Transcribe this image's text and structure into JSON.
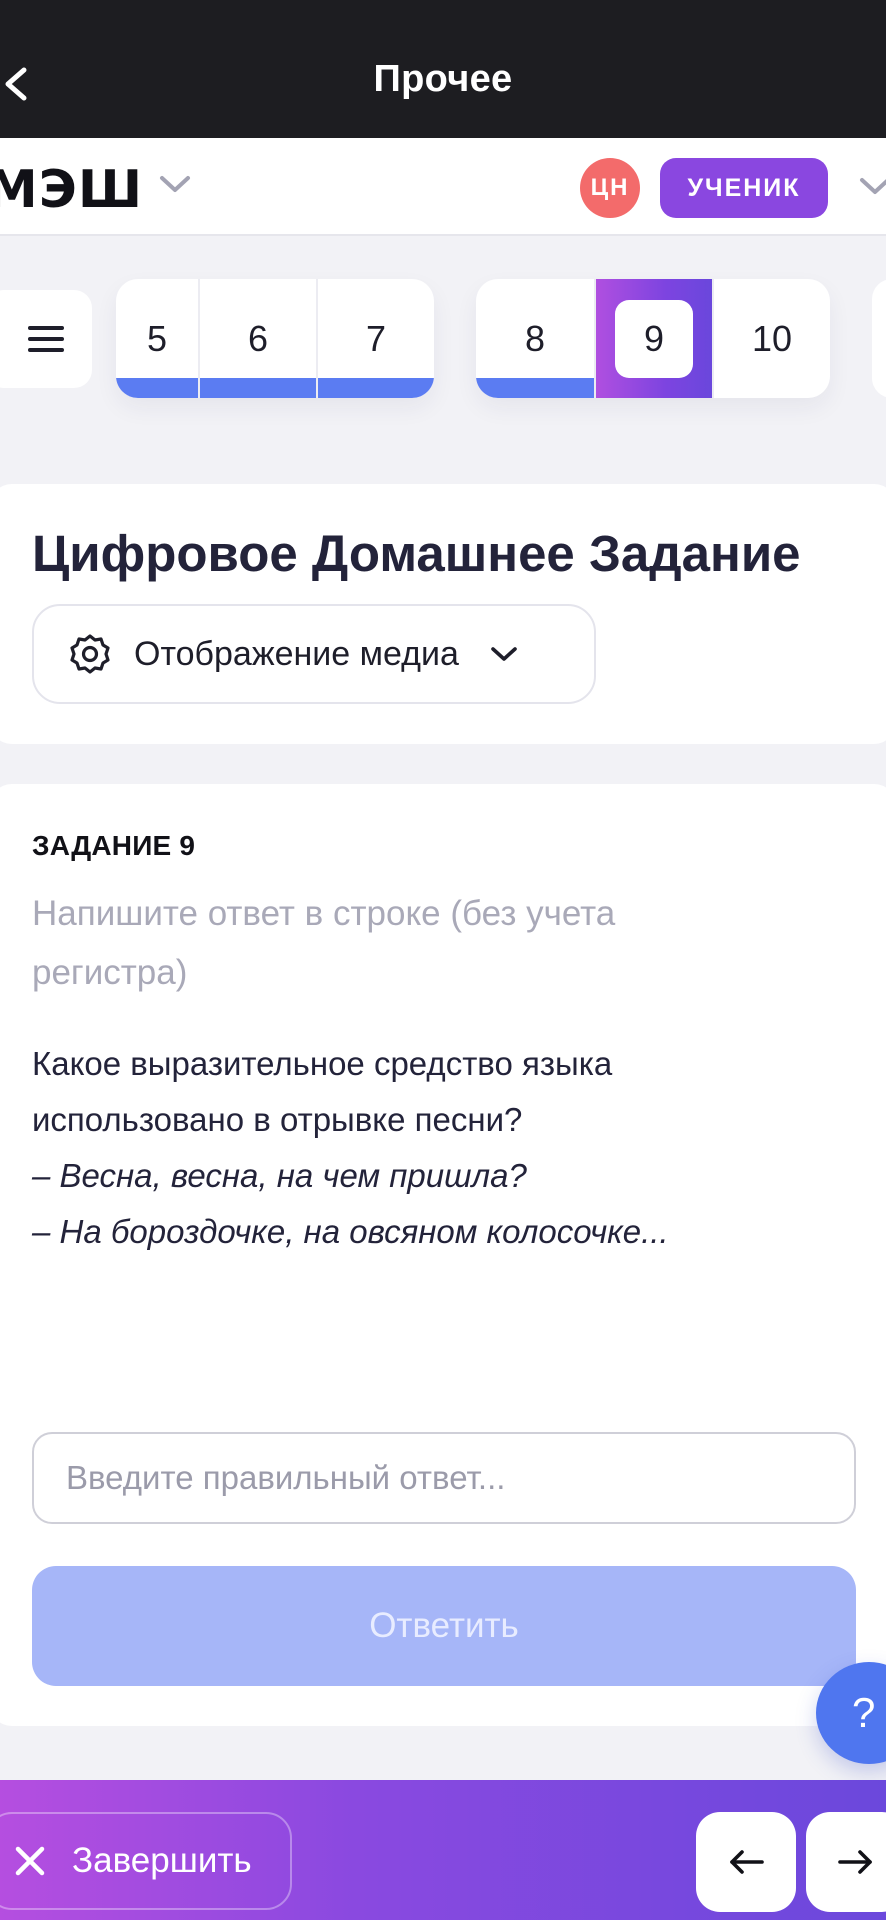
{
  "topbar": {
    "title": "Прочее"
  },
  "header": {
    "logo_text": "МЭШ",
    "avatar_initials": "ЦН",
    "role_badge": "УЧЕНИК"
  },
  "task_nav": {
    "groups": [
      {
        "tasks": [
          {
            "number": "5",
            "status": "done"
          },
          {
            "number": "6",
            "status": "done"
          },
          {
            "number": "7",
            "status": "done"
          }
        ]
      },
      {
        "tasks": [
          {
            "number": "8",
            "status": "done"
          },
          {
            "number": "9",
            "status": "active"
          },
          {
            "number": "10",
            "status": "pending"
          }
        ]
      }
    ]
  },
  "page": {
    "title": "Цифровое Домашнее Задание",
    "media_button": "Отображение медиа"
  },
  "task": {
    "label": "ЗАДАНИЕ 9",
    "hint": "Напишите ответ в строке (без учета регистра)",
    "question": "Какое выразительное средство языка использовано в отрывке песни?",
    "quote_lines": [
      "– Весна, весна, на чем пришла?",
      "– На бороздочке, на овсяном колосочке..."
    ],
    "answer_placeholder": "Введите правильный ответ...",
    "submit_label": "Ответить"
  },
  "help": {
    "label": "?"
  },
  "bottombar": {
    "finish_label": "Завершить"
  },
  "colors": {
    "topbar": "#1d1d21",
    "accent_purple": "#8a47e0",
    "progress_blue": "#5b7cf2",
    "submit_disabled": "#a6b6f8",
    "avatar": "#f36b6b",
    "help": "#4f76ef"
  }
}
